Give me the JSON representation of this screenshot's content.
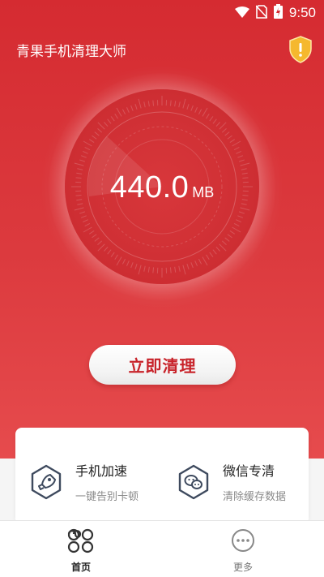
{
  "status_bar": {
    "time": "9:50",
    "icons": [
      "wifi-icon",
      "no-sim-icon",
      "battery-charging-icon"
    ]
  },
  "app": {
    "title": "青果手机清理大师",
    "alert_icon": "shield-warning-icon"
  },
  "dial": {
    "value": "440.0",
    "unit": "MB"
  },
  "clean_button": {
    "label": "立即清理"
  },
  "features": [
    {
      "title": "手机加速",
      "subtitle": "一键告别卡顿",
      "icon": "rocket-icon"
    },
    {
      "title": "微信专清",
      "subtitle": "清除缓存数据",
      "icon": "wechat-icon"
    }
  ],
  "nav": {
    "home_label": "首页",
    "more_label": "更多"
  },
  "colors": {
    "primary_red": "#d52b31",
    "button_text": "#c8232a",
    "alert_yellow": "#f5b82e"
  }
}
